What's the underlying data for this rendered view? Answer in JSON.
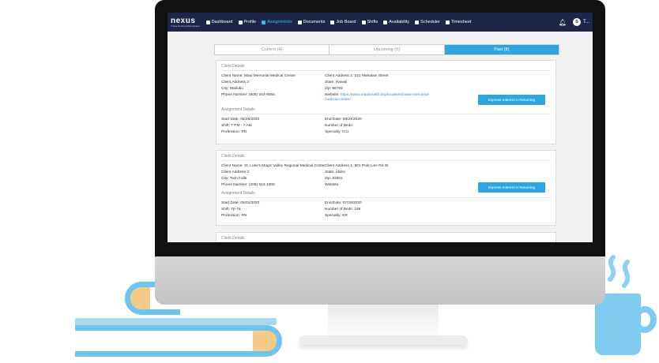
{
  "nav": {
    "logo_main": "nexus",
    "logo_sub": "Travel Nursing Marketplace",
    "items": [
      {
        "label": "Dashboard",
        "icon": "dashboard-icon"
      },
      {
        "label": "Profile",
        "icon": "profile-icon"
      },
      {
        "label": "Assignments",
        "icon": "assignments-icon"
      },
      {
        "label": "Documents",
        "icon": "documents-icon"
      },
      {
        "label": "Job Board",
        "icon": "job-board-icon"
      },
      {
        "label": "Shifts",
        "icon": "shifts-icon"
      },
      {
        "label": "Availability",
        "icon": "availability-icon"
      },
      {
        "label": "Scheduler",
        "icon": "scheduler-icon"
      },
      {
        "label": "Timesheet",
        "icon": "timesheet-icon"
      }
    ],
    "active": "Assignments",
    "avatar_initial": "S",
    "user_label": "T..."
  },
  "tabs": [
    {
      "label": "Current (4)"
    },
    {
      "label": "Upcoming (0)"
    },
    {
      "label": "Past (8)"
    }
  ],
  "active_tab": "Past (8)",
  "cards": [
    {
      "client_title": "Client Details",
      "client_name": "Client Name: Maui Memorial Medical Center",
      "client_address1": "Client Address 1: 221 Mahalani Street",
      "client_address2": "Client Address 2:",
      "state": "State: Hawaii",
      "city": "City: Wailuku",
      "zip": "Zip: 96793",
      "phone": "Phone Number: (808) 244-9056",
      "website_label": "Website:",
      "website_url": "https://www.mauihealth.org/locations/maui-memorial-medical-center/",
      "assignment_title": "Assignment Details",
      "start_date": "Start Date: 05/25/2020",
      "end_date": "End Date: 08/24/2020",
      "shift": "Shift: 7 PM - 7 AM",
      "beds": "Number of Beds:",
      "profession": "Profession: RN",
      "specialty": "Specialty: ICU",
      "button": "Express Interest in Returning"
    },
    {
      "client_title": "Client Details",
      "client_name": "Client Name: St. Luke's Magic Valley Regional Medical Center",
      "client_address1": "Client Address 1: 801 Pole Line Rd W",
      "client_address2": "Client Address 2:",
      "state": "State: Idaho",
      "city": "City: Twin Falls",
      "zip": "Zip: 83301",
      "phone": "Phone Number: (208) 814-1000",
      "website_label": "Website:",
      "assignment_title": "Assignment Details",
      "start_date": "Start Date: 05/01/2020",
      "end_date": "End Date: 07/29/2020",
      "shift": "Shift: 7p-7a",
      "beds": "Number of Beds: 186",
      "profession": "Profession: RN",
      "specialty": "Specialty: ER",
      "button": "Express Interest in Returning"
    },
    {
      "client_title": "Client Details"
    }
  ],
  "colors": {
    "navbar": "#1d2549",
    "accent": "#2ea6dc",
    "active_nav": "#3fb9ea"
  }
}
